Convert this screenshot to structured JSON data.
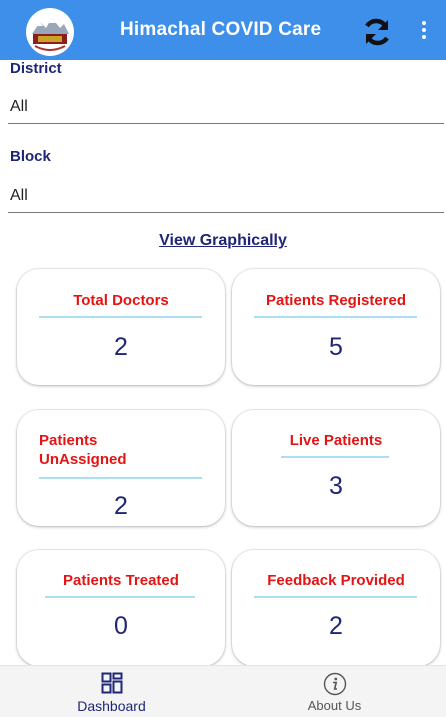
{
  "app_bar": {
    "title": "Himachal COVID Care",
    "logo_icon": "himachal-emblem-icon",
    "refresh_icon": "refresh-icon",
    "menu_icon": "more-vert-icon",
    "color": "#3d8fea"
  },
  "filters": {
    "district": {
      "label": "District",
      "value": "All"
    },
    "block": {
      "label": "Block",
      "value": "All"
    }
  },
  "view_graphically": "View Graphically",
  "cards": [
    {
      "title": "Total Doctors",
      "value": "2"
    },
    {
      "title": "Patients Registered",
      "value": "5"
    },
    {
      "title": "Patients UnAssigned",
      "value": "2"
    },
    {
      "title": "Live Patients",
      "value": "3"
    },
    {
      "title": "Patients Treated",
      "value": "0"
    },
    {
      "title": "Feedback Provided",
      "value": "2"
    }
  ],
  "bottom_nav": [
    {
      "label": "Dashboard",
      "icon": "dashboard-icon",
      "active": true
    },
    {
      "label": "About Us",
      "icon": "info-icon",
      "active": false
    }
  ],
  "colors": {
    "title_red": "#e31414",
    "navy": "#1f2677",
    "accent_line": "#a9dff0"
  }
}
